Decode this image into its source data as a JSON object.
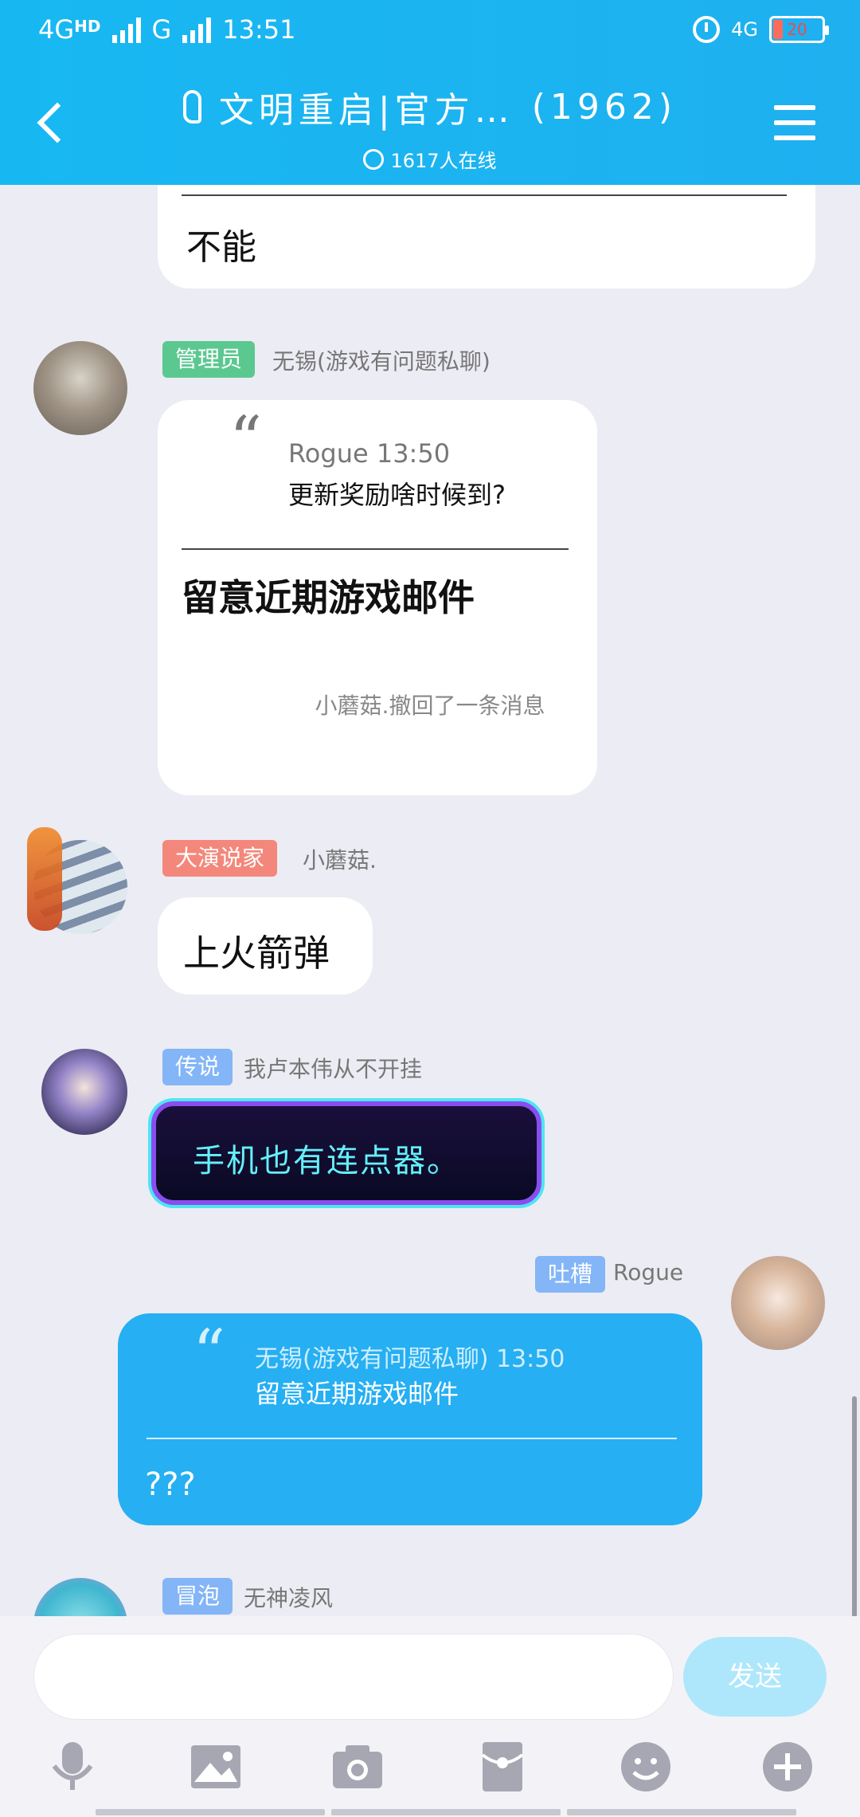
{
  "status": {
    "network_left": "4G",
    "network_sup": "HD",
    "network_g": "G",
    "time": "13:51",
    "network_right": "4G",
    "battery": "20"
  },
  "header": {
    "title": "文明重启|官方…",
    "member_count": "(1962)",
    "online": "1617人在线"
  },
  "messages": {
    "m0": {
      "text": "不能"
    },
    "m1": {
      "tag": "管理员",
      "nick": "无锡(游戏有问题私聊)",
      "quote_author": "Rogue 13:50",
      "quote_text": "更新奖励啥时候到?",
      "text": "留意近期游戏邮件"
    },
    "recall": "小蘑菇.撤回了一条消息",
    "m2": {
      "tag": "大演说家",
      "nick": "小蘑菇.",
      "text": "上火箭弹"
    },
    "m3": {
      "tag": "传说",
      "nick": "我卢本伟从不开挂",
      "text": "手机也有连点器。"
    },
    "m4": {
      "tag": "吐槽",
      "nick": "Rogue",
      "quote_author": "无锡(游戏有问题私聊) 13:50",
      "quote_text": "留意近期游戏邮件",
      "text": "???"
    },
    "m5": {
      "tag": "冒泡",
      "nick": "无神凌风"
    }
  },
  "input": {
    "send_label": "发送"
  },
  "colors": {
    "header": "#1fb0f0",
    "tag_admin": "#5bc890",
    "tag_speaker": "#f4877b",
    "tag_blue": "#83b5f7",
    "my_bubble": "#26aff2"
  }
}
